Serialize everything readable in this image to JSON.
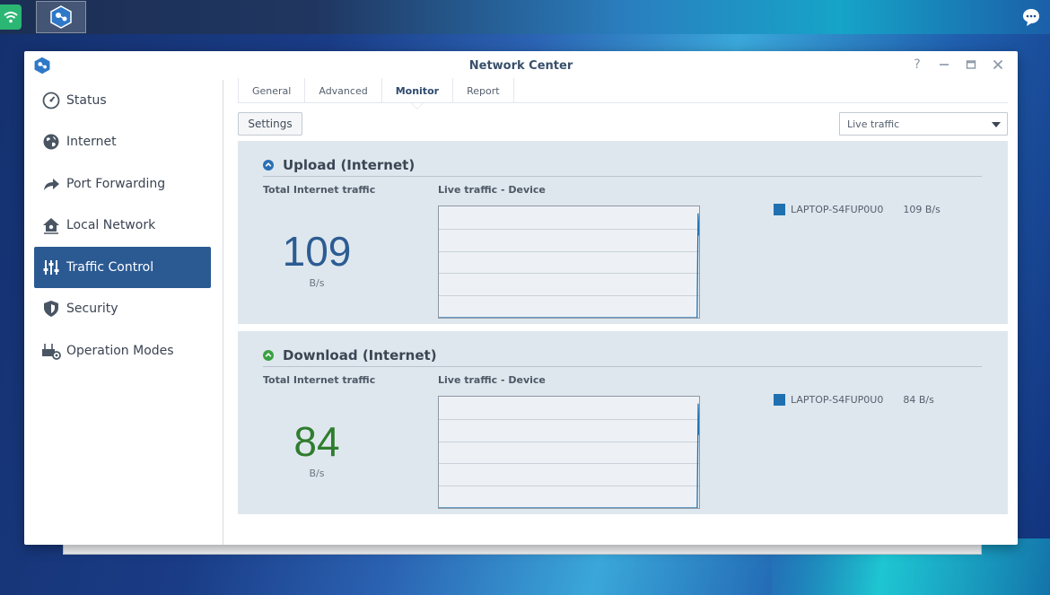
{
  "window": {
    "title": "Network Center"
  },
  "colors": {
    "accent": "#2b5a93",
    "upload_blue": "#2c5c92",
    "download_green": "#2f7d2e",
    "series": "#1f70b0"
  },
  "sidebar": {
    "items": [
      {
        "label": "Status",
        "icon": "gauge-icon"
      },
      {
        "label": "Internet",
        "icon": "globe-icon"
      },
      {
        "label": "Port Forwarding",
        "icon": "forward-arrow-icon"
      },
      {
        "label": "Local Network",
        "icon": "home-network-icon"
      },
      {
        "label": "Traffic Control",
        "icon": "sliders-icon",
        "active": true
      },
      {
        "label": "Security",
        "icon": "shield-icon"
      },
      {
        "label": "Operation Modes",
        "icon": "router-gear-icon"
      }
    ]
  },
  "tabs": [
    {
      "label": "General"
    },
    {
      "label": "Advanced"
    },
    {
      "label": "Monitor",
      "active": true
    },
    {
      "label": "Report"
    }
  ],
  "toolbar": {
    "settings_label": "Settings",
    "select_value": "Live traffic"
  },
  "upload": {
    "title": "Upload (Internet)",
    "total_label": "Total Internet traffic",
    "live_label": "Live traffic - Device",
    "value": "109",
    "unit": "B/s",
    "legend_device": "LAPTOP-S4FUP0U0",
    "legend_value": "109 B/s"
  },
  "download": {
    "title": "Download (Internet)",
    "total_label": "Total Internet traffic",
    "live_label": "Live traffic - Device",
    "value": "84",
    "unit": "B/s",
    "legend_device": "LAPTOP-S4FUP0U0",
    "legend_value": "84 B/s"
  },
  "chart_data": [
    {
      "type": "line",
      "series": [
        {
          "name": "LAPTOP-S4FUP0U0",
          "values": [
            0,
            0,
            0,
            0,
            0,
            0,
            0,
            0,
            0,
            0,
            0,
            0,
            0,
            0,
            0,
            0,
            0,
            0,
            0,
            0,
            0,
            0,
            0,
            0,
            0,
            0,
            0,
            0,
            0,
            0,
            0,
            0,
            0,
            0,
            0,
            0,
            0,
            0,
            0,
            0,
            0,
            0,
            0,
            0,
            0,
            0,
            0,
            0,
            0,
            0,
            0,
            0,
            0,
            0,
            0,
            0,
            0,
            0,
            0,
            0,
            0,
            0,
            0,
            0,
            0,
            0,
            0,
            0,
            0,
            0,
            0,
            0,
            0,
            0,
            0,
            0,
            0,
            0,
            0,
            0,
            0,
            0,
            0,
            0,
            0,
            0,
            0,
            0,
            0,
            0,
            0,
            0,
            0,
            0,
            0,
            0,
            0,
            0,
            0,
            0,
            0,
            0,
            0,
            0,
            0,
            0,
            0,
            0,
            0,
            0,
            0,
            0,
            0,
            0,
            0,
            0,
            0,
            0,
            0,
            0,
            0,
            0,
            0,
            0,
            0,
            0,
            0,
            0,
            0,
            0,
            0,
            0,
            0,
            0,
            0,
            0,
            0,
            0,
            0,
            0,
            0,
            0,
            0,
            0,
            0,
            0,
            0,
            0,
            0,
            0,
            0,
            0,
            0,
            0,
            0,
            0,
            0,
            0,
            0,
            0,
            0,
            0,
            0,
            0,
            0,
            0,
            0,
            0,
            0,
            0,
            0,
            0,
            0,
            0,
            0,
            0,
            0,
            0,
            0,
            0,
            0,
            0,
            0,
            0,
            0,
            0,
            0,
            0,
            0,
            0,
            0,
            0,
            0,
            0,
            0,
            0,
            0,
            0,
            0,
            0,
            0,
            0,
            0,
            0,
            0,
            0,
            0,
            0,
            0,
            0,
            0,
            0,
            0,
            0,
            0,
            0,
            0,
            0,
            0,
            0,
            0,
            0,
            0,
            0,
            0,
            0,
            0,
            0,
            0,
            0,
            0,
            0,
            0,
            0,
            0,
            0,
            0,
            0,
            0,
            0,
            0,
            0,
            0,
            0,
            0,
            0,
            0,
            0,
            0,
            0,
            0,
            0,
            0,
            0,
            0,
            0,
            0,
            0,
            0,
            0,
            0,
            0,
            0,
            0,
            0,
            0,
            150,
            118
          ]
        }
      ],
      "ylim": [
        0,
        160
      ],
      "grid": true
    },
    {
      "type": "line",
      "series": [
        {
          "name": "LAPTOP-S4FUP0U0",
          "values": [
            0,
            0,
            0,
            0,
            0,
            0,
            0,
            0,
            0,
            0,
            0,
            0,
            0,
            0,
            0,
            0,
            0,
            0,
            0,
            0,
            0,
            0,
            0,
            0,
            0,
            0,
            0,
            0,
            0,
            0,
            0,
            0,
            0,
            0,
            0,
            0,
            0,
            0,
            0,
            0,
            0,
            0,
            0,
            0,
            0,
            0,
            0,
            0,
            0,
            0,
            0,
            0,
            0,
            0,
            0,
            0,
            0,
            0,
            0,
            0,
            0,
            0,
            0,
            0,
            0,
            0,
            0,
            0,
            0,
            0,
            0,
            0,
            0,
            0,
            0,
            0,
            0,
            0,
            0,
            0,
            0,
            0,
            0,
            0,
            0,
            0,
            0,
            0,
            0,
            0,
            0,
            0,
            0,
            0,
            0,
            0,
            0,
            0,
            0,
            0,
            0,
            0,
            0,
            0,
            0,
            0,
            0,
            0,
            0,
            0,
            0,
            0,
            0,
            0,
            0,
            0,
            0,
            0,
            0,
            0,
            0,
            0,
            0,
            0,
            0,
            0,
            0,
            0,
            0,
            0,
            0,
            0,
            0,
            0,
            0,
            0,
            0,
            0,
            0,
            0,
            0,
            0,
            0,
            0,
            0,
            0,
            0,
            0,
            0,
            0,
            0,
            0,
            0,
            0,
            0,
            0,
            0,
            0,
            0,
            0,
            0,
            0,
            0,
            0,
            0,
            0,
            0,
            0,
            0,
            0,
            0,
            0,
            0,
            0,
            0,
            0,
            0,
            0,
            0,
            0,
            0,
            0,
            0,
            0,
            0,
            0,
            0,
            0,
            0,
            0,
            0,
            0,
            0,
            0,
            0,
            0,
            0,
            0,
            0,
            0,
            0,
            0,
            0,
            0,
            0,
            0,
            0,
            0,
            0,
            0,
            0,
            0,
            0,
            0,
            0,
            0,
            0,
            0,
            0,
            0,
            0,
            0,
            0,
            0,
            0,
            0,
            0,
            0,
            0,
            0,
            0,
            0,
            0,
            0,
            0,
            0,
            0,
            0,
            0,
            0,
            0,
            0,
            0,
            0,
            0,
            0,
            0,
            0,
            0,
            0,
            0,
            0,
            0,
            0,
            0,
            0,
            0,
            0,
            0,
            0,
            0,
            0,
            0,
            0,
            0,
            0,
            0,
            0,
            0,
            0,
            0,
            0,
            0,
            0,
            0,
            0,
            0,
            150,
            105
          ]
        }
      ],
      "ylim": [
        0,
        160
      ],
      "grid": true
    }
  ]
}
